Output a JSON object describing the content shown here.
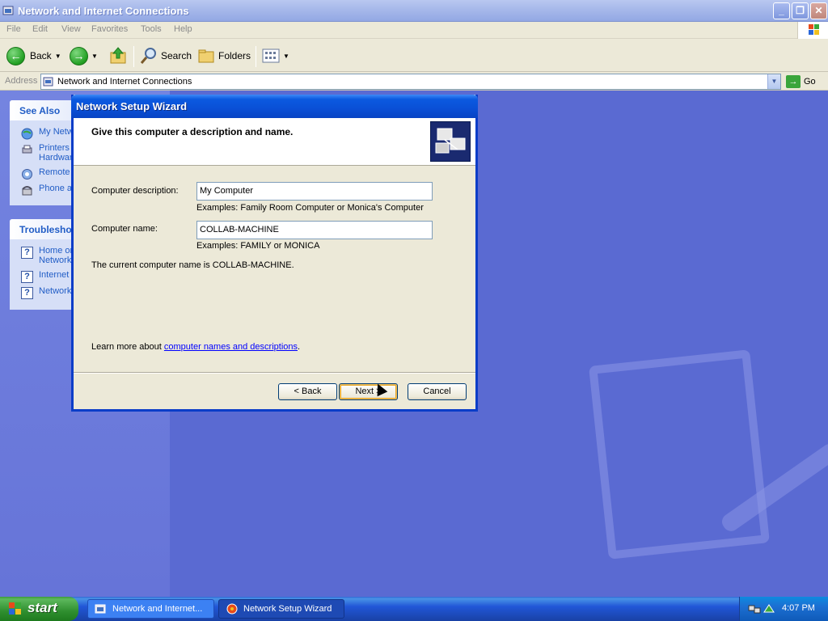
{
  "window": {
    "title": "Network and Internet Connections",
    "buttons": {
      "minimize": "_",
      "maximize": "❐",
      "close": "✕"
    }
  },
  "menu": [
    "File",
    "Edit",
    "View",
    "Favorites",
    "Tools",
    "Help"
  ],
  "toolbar": {
    "back": "Back",
    "search": "Search",
    "folders": "Folders"
  },
  "address": {
    "label": "Address",
    "value": "Network and Internet Connections",
    "go": "Go"
  },
  "sidebar": {
    "see_also": {
      "title": "See Also",
      "items": [
        "My Netw",
        "Printers",
        "Hardwar",
        "Remote",
        "Phone a"
      ]
    },
    "troubleshooters": {
      "title": "Troublesho",
      "items": [
        "Home or",
        "Network",
        "Internet",
        "Network"
      ]
    }
  },
  "wizard": {
    "title": "Network Setup Wizard",
    "heading": "Give this computer a description and name.",
    "description_label": "Computer description:",
    "description_value": "My Computer",
    "description_hint": "Examples: Family Room Computer or Monica's Computer",
    "name_label": "Computer name:",
    "name_value": "COLLAB-MACHINE",
    "name_hint": "Examples: FAMILY or MONICA",
    "current_name": "The current computer name is COLLAB-MACHINE.",
    "learn_prefix": "Learn more about",
    "learn_link": "computer names and descriptions",
    "learn_suffix": ".",
    "back_button": "< Back",
    "next_button": "Next >",
    "cancel_button": "Cancel"
  },
  "taskbar": {
    "start": "start",
    "tasks": [
      "Network and Internet...",
      "Network Setup Wizard"
    ],
    "clock": "4:07 PM"
  },
  "colors": {
    "dialog_title": "#0a4fd6",
    "desktop": "#5a6ad2",
    "link": "#0000ff"
  }
}
